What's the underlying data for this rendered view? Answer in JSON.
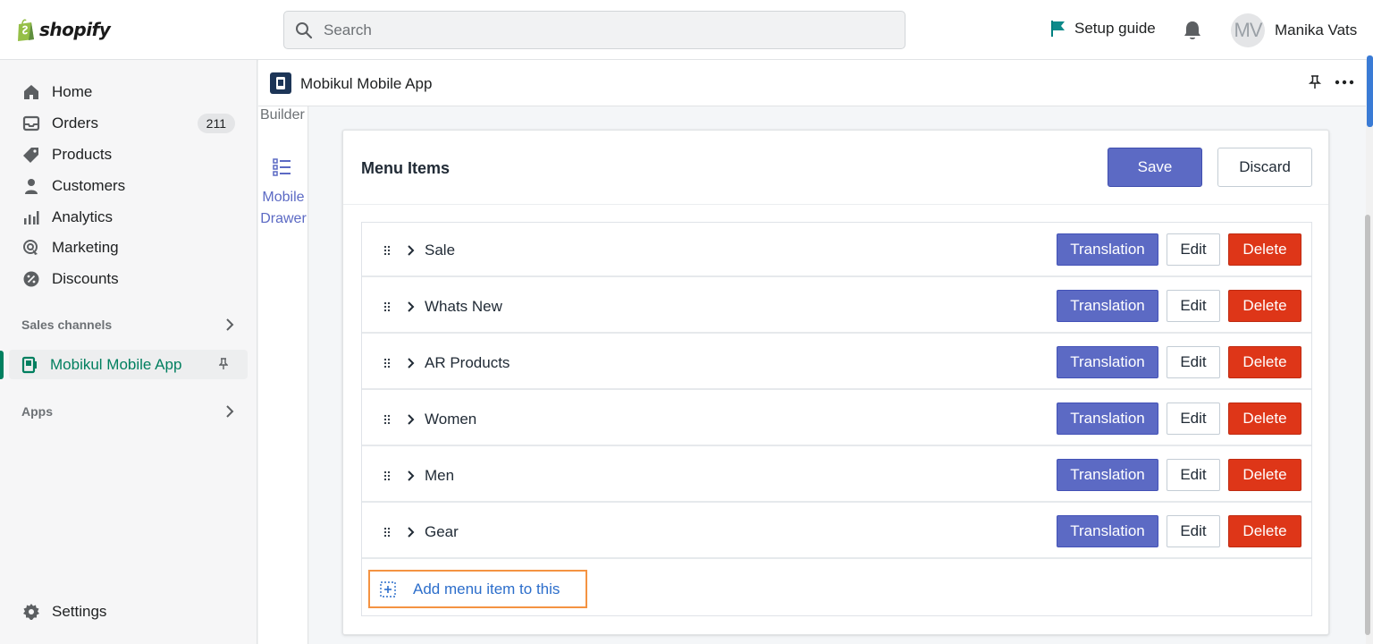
{
  "topbar": {
    "logo_text": "shopify",
    "search_placeholder": "Search",
    "setup_guide": "Setup guide",
    "avatar_initials": "MV",
    "username": "Manika Vats"
  },
  "sidebar": {
    "items": [
      {
        "label": "Home",
        "icon": "home-icon"
      },
      {
        "label": "Orders",
        "icon": "orders-icon",
        "badge": "211"
      },
      {
        "label": "Products",
        "icon": "tag-icon"
      },
      {
        "label": "Customers",
        "icon": "person-icon"
      },
      {
        "label": "Analytics",
        "icon": "bar-chart-icon"
      },
      {
        "label": "Marketing",
        "icon": "target-icon"
      },
      {
        "label": "Discounts",
        "icon": "discount-icon"
      }
    ],
    "sales_channels": "Sales channels",
    "app_item": "Mobikul Mobile App",
    "apps": "Apps",
    "settings": "Settings"
  },
  "app_header": {
    "title": "Mobikul Mobile App"
  },
  "builder": {
    "label": "Builder",
    "drawer_label_1": "Mobile",
    "drawer_label_2": "Drawer"
  },
  "card": {
    "title": "Menu Items",
    "save": "Save",
    "discard": "Discard",
    "translation_label": "Translation",
    "edit_label": "Edit",
    "delete_label": "Delete",
    "rows": [
      "Sale",
      "Whats New",
      "AR Products",
      "Women",
      "Men",
      "Gear"
    ],
    "add_item": "Add menu item to this"
  },
  "colors": {
    "primary": "#5c6ac4",
    "danger": "#de3618",
    "active_green": "#007f5f",
    "highlight_orange": "#f49342"
  }
}
